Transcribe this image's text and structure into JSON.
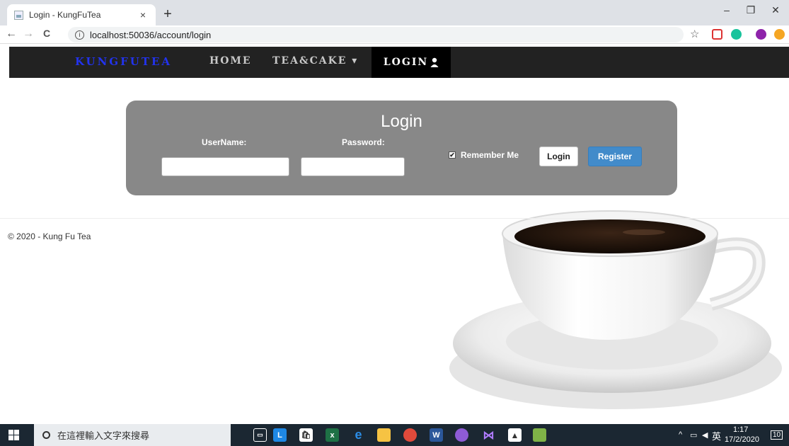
{
  "browser": {
    "tab_title": "Login - KungFuTea",
    "tab_close": "×",
    "new_tab": "+",
    "url": "localhost:50036/account/login",
    "window_controls": {
      "minimize": "–",
      "restore": "❐",
      "close": "✕"
    },
    "nav": {
      "back": "←",
      "forward": "→",
      "reload": "C"
    }
  },
  "navbar": {
    "brand": "KUNGFUTEA",
    "links": [
      {
        "label": "HOME"
      },
      {
        "label": "TEA&CAKE ▾"
      }
    ],
    "active": "LOGIN"
  },
  "login": {
    "title": "Login",
    "username_label": "UserName:",
    "password_label": "Password:",
    "username_value": "",
    "password_value": "",
    "remember_label": "Remember Me",
    "remember_checked": true,
    "login_button": "Login",
    "register_button": "Register"
  },
  "footer": {
    "text": "© 2020 - Kung Fu Tea"
  },
  "taskbar": {
    "search_placeholder": "在這裡輸入文字來搜尋",
    "tray_lang": "英",
    "time": "1:17",
    "date": "17/2/2020",
    "notifications": "10"
  },
  "colors": {
    "navbar_bg": "#222222",
    "brand": "#2233ee",
    "panel_bg": "#888888",
    "register_button": "#428bca",
    "taskbar": "#1b2732"
  }
}
